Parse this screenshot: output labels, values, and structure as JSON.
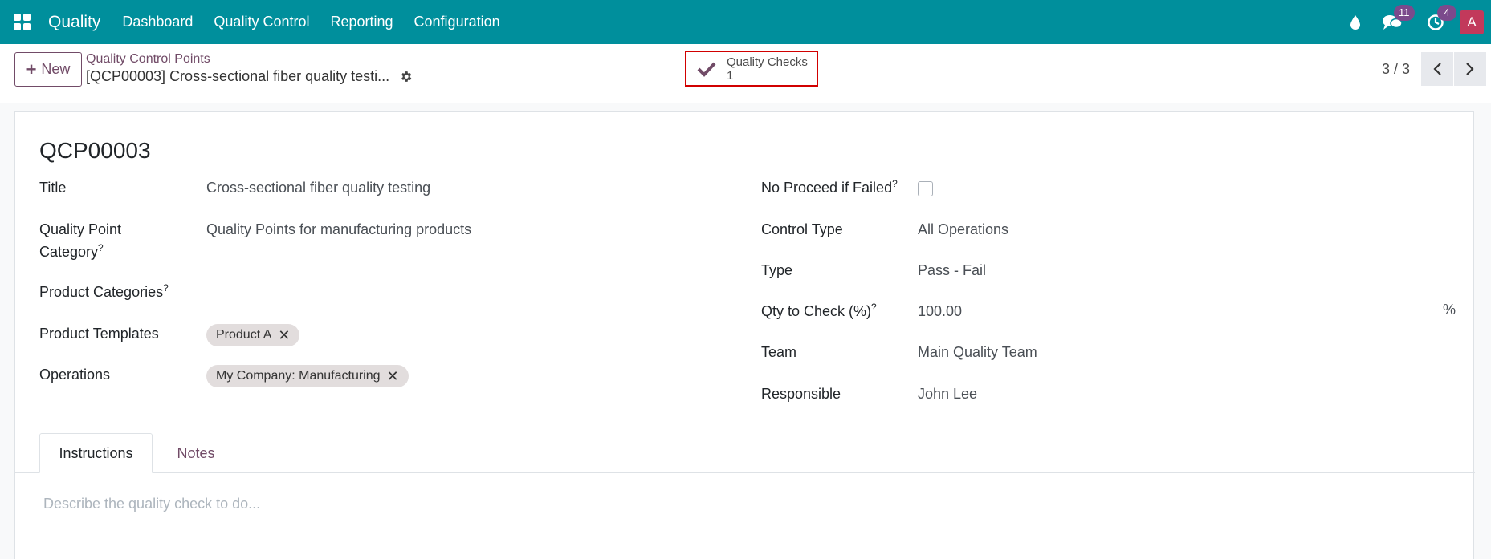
{
  "navbar": {
    "app_name": "Quality",
    "menu": [
      "Dashboard",
      "Quality Control",
      "Reporting",
      "Configuration"
    ],
    "messages_count": "11",
    "activities_count": "4",
    "avatar_initial": "A",
    "bg_color": "#008f9c"
  },
  "control_panel": {
    "new_label": "New",
    "breadcrumb_parent": "Quality Control Points",
    "breadcrumb_current": "[QCP00003] Cross-sectional fiber quality testi...",
    "smart_button": {
      "label": "Quality Checks",
      "count": "1"
    },
    "pager": "3 / 3"
  },
  "form": {
    "name": "QCP00003",
    "left_fields": {
      "title_label": "Title",
      "title_value": "Cross-sectional fiber quality testing",
      "category_label_line1": "Quality Point",
      "category_label_line2": "Category",
      "category_value": "Quality Points for manufacturing products",
      "product_categories_label": "Product Categories",
      "product_templates_label": "Product Templates",
      "product_templates_tags": [
        "Product A"
      ],
      "operations_label": "Operations",
      "operations_tags": [
        "My Company: Manufacturing"
      ]
    },
    "right_fields": {
      "no_proceed_label": "No Proceed if Failed",
      "no_proceed_checked": false,
      "control_type_label": "Control Type",
      "control_type_value": "All Operations",
      "type_label": "Type",
      "type_value": "Pass - Fail",
      "qty_label": "Qty to Check (%)",
      "qty_value": "100.00",
      "qty_unit": "%",
      "team_label": "Team",
      "team_value": "Main Quality Team",
      "responsible_label": "Responsible",
      "responsible_value": "John Lee"
    },
    "help_mark": "?",
    "tabs": [
      "Instructions",
      "Notes"
    ],
    "instructions_placeholder": "Describe the quality check to do..."
  },
  "icons": [
    "apps-grid-icon",
    "droplet-icon",
    "chat-icon",
    "clock-icon",
    "gear-icon",
    "check-icon",
    "chevron-left-icon",
    "chevron-right-icon",
    "close-icon"
  ]
}
